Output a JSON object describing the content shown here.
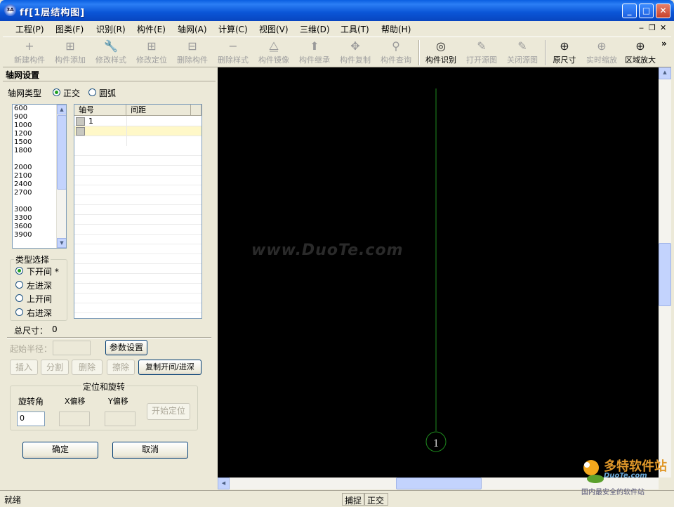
{
  "window": {
    "title": "ff[1层结构图]",
    "icon_text": "3A"
  },
  "menu": [
    "工程(P)",
    "图类(F)",
    "识别(R)",
    "构件(E)",
    "轴网(A)",
    "计算(C)",
    "视图(V)",
    "三维(D)",
    "工具(T)",
    "帮助(H)"
  ],
  "mdi_controls": [
    "‒",
    "❐",
    "✕"
  ],
  "toolbar": [
    {
      "label": "新建构件",
      "icon": "+",
      "enabled": false
    },
    {
      "label": "构件添加",
      "icon": "⊞",
      "enabled": false
    },
    {
      "label": "修改样式",
      "icon": "🔧",
      "enabled": false
    },
    {
      "label": "修改定位",
      "icon": "⊞",
      "enabled": false
    },
    {
      "label": "删除构件",
      "icon": "⊟",
      "enabled": false
    },
    {
      "label": "删除样式",
      "icon": "−",
      "enabled": false
    },
    {
      "label": "构件镜像",
      "icon": "⧋",
      "enabled": false
    },
    {
      "label": "构件继承",
      "icon": "⬆",
      "enabled": false
    },
    {
      "label": "构件复制",
      "icon": "✥",
      "enabled": false
    },
    {
      "label": "构件查询",
      "icon": "⚲",
      "enabled": false
    },
    {
      "label": "构件识别",
      "icon": "◎",
      "enabled": true
    },
    {
      "label": "打开源图",
      "icon": "✎",
      "enabled": false
    },
    {
      "label": "关闭源图",
      "icon": "✎",
      "enabled": false
    },
    {
      "label": "原尺寸",
      "icon": "⊕",
      "enabled": true
    },
    {
      "label": "实时缩放",
      "icon": "⊕",
      "enabled": false
    },
    {
      "label": "区域放大",
      "icon": "⊕",
      "enabled": true
    }
  ],
  "toolbar_more": "»",
  "panel": {
    "title": "轴网设置",
    "grid_type_label": "轴网类型",
    "grid_type_options": [
      "正交",
      "圆弧"
    ],
    "grid_type_selected": 0,
    "spacing_list": [
      "600",
      "900",
      "1000",
      "1200",
      "1500",
      "1800",
      "",
      "2000",
      "2100",
      "2400",
      "2700",
      "",
      "3000",
      "3300",
      "3600",
      "3900"
    ],
    "table": {
      "headers": [
        "轴号",
        "间距"
      ],
      "rows": [
        [
          "1",
          ""
        ],
        [
          "",
          ""
        ]
      ]
    },
    "type_select": {
      "title": "类型选择",
      "options": [
        "下开间 *",
        "左进深",
        "上开间",
        "右进深"
      ],
      "selected": 0
    },
    "total_size_label": "总尺寸：",
    "total_size_value": "0",
    "start_radius_label": "起始半径：",
    "param_button": "参数设置",
    "action_buttons": [
      {
        "label": "插入",
        "enabled": false
      },
      {
        "label": "分割",
        "enabled": false
      },
      {
        "label": "删除",
        "enabled": false
      },
      {
        "label": "擦除",
        "enabled": false
      },
      {
        "label": "复制开间/进深",
        "enabled": true
      }
    ],
    "position": {
      "title": "定位和旋转",
      "rotate_label": "旋转角",
      "x_label": "X偏移",
      "y_label": "Y偏移",
      "rotate_value": "0",
      "start_button": "开始定位"
    },
    "ok_button": "确定",
    "cancel_button": "取消"
  },
  "canvas": {
    "axis_label": "1",
    "axis_color": "#1e8a1e",
    "watermark": "www.DuoTe.com"
  },
  "status": {
    "left": "就绪",
    "snap": "捕捉",
    "ortho": "正交"
  },
  "logo": {
    "name": "多特软件站",
    "domain": "DuoTe.com",
    "slogan": "国内最安全的软件站"
  }
}
